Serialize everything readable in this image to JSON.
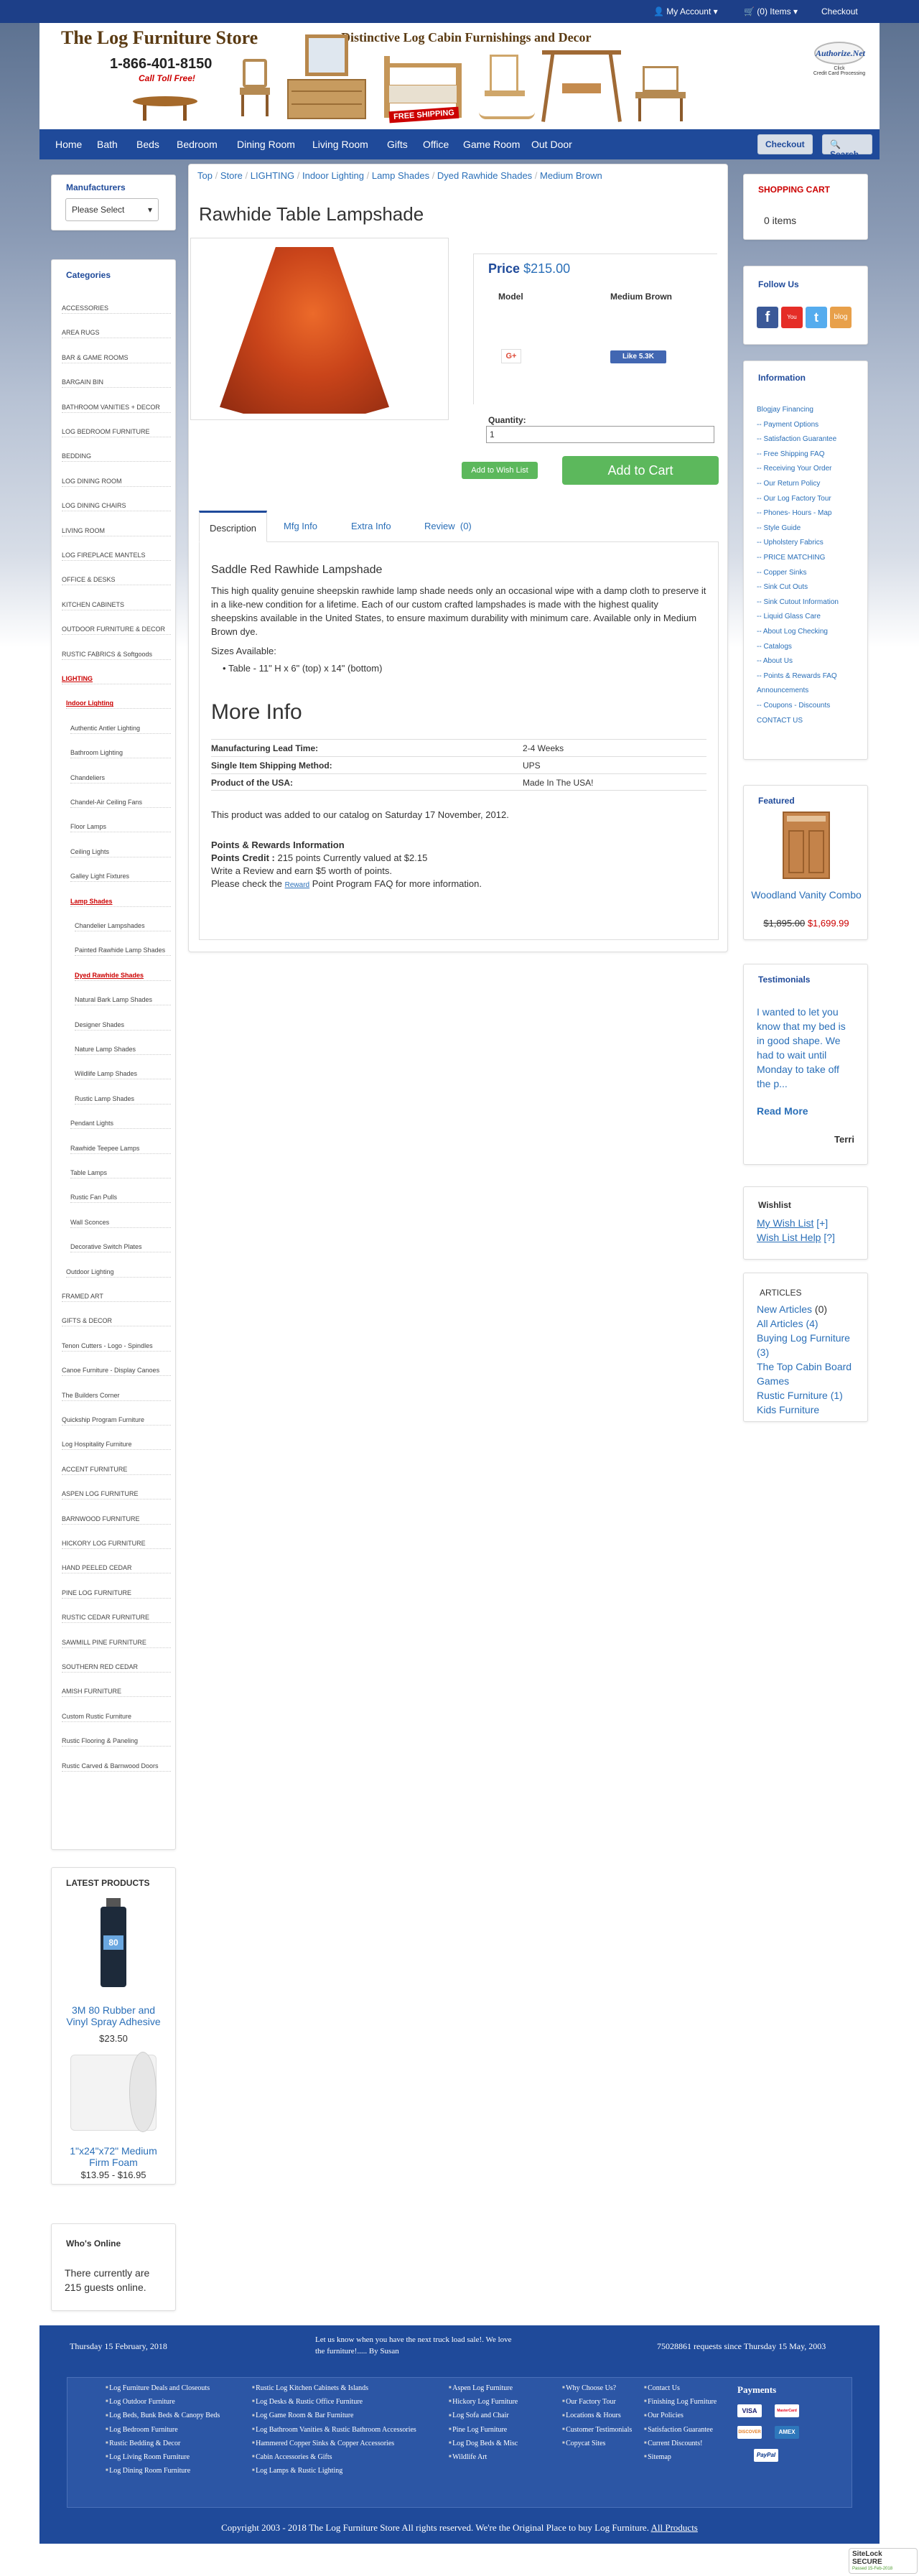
{
  "topbar": {
    "account": "My Account",
    "cart": "(0) Items",
    "checkout": "Checkout"
  },
  "header": {
    "store_name": "The Log Furniture Store",
    "tagline": "Distinctive Log Cabin Furnishings and Decor",
    "phone": "1-866-401-8150",
    "toll_free": "Call Toll Free!",
    "free_shipping": "FREE SHIPPING",
    "authorize": "Authorize.Net",
    "authorize_sub": "Credit Card Processing",
    "click": "Click"
  },
  "nav": {
    "items": [
      "Home",
      "Bath",
      "Beds",
      "Bedroom",
      "Dining Room",
      "Living Room",
      "Gifts",
      "Office",
      "Game Room",
      "Out Door"
    ],
    "checkout": "Checkout",
    "search": "Search"
  },
  "manufacturers": {
    "title": "Manufacturers",
    "select": "Please Select"
  },
  "categories": {
    "title": "Categories",
    "items": [
      {
        "t": "ACCESSORIES",
        "lvl": 0
      },
      {
        "t": "AREA RUGS",
        "lvl": 0
      },
      {
        "t": "BAR & GAME ROOMS",
        "lvl": 0
      },
      {
        "t": "BARGAIN BIN",
        "lvl": 0
      },
      {
        "t": "BATHROOM VANITIES + DECOR",
        "lvl": 0
      },
      {
        "t": "LOG BEDROOM FURNITURE",
        "lvl": 0
      },
      {
        "t": "BEDDING",
        "lvl": 0
      },
      {
        "t": "LOG DINING ROOM",
        "lvl": 0
      },
      {
        "t": "LOG DINING CHAIRS",
        "lvl": 0
      },
      {
        "t": "LIVING ROOM",
        "lvl": 0
      },
      {
        "t": "LOG FIREPLACE MANTELS",
        "lvl": 0
      },
      {
        "t": "OFFICE & DESKS",
        "lvl": 0
      },
      {
        "t": "KITCHEN CABINETS",
        "lvl": 0
      },
      {
        "t": "OUTDOOR FURNITURE & DECOR",
        "lvl": 0
      },
      {
        "t": "RUSTIC FABRICS & Softgoods",
        "lvl": 0
      },
      {
        "t": "LIGHTING",
        "lvl": 0,
        "red": true
      },
      {
        "t": "Indoor Lighting",
        "lvl": 1,
        "red": true
      },
      {
        "t": "Authentic Antler Lighting",
        "lvl": 2
      },
      {
        "t": "Bathroom Lighting",
        "lvl": 2
      },
      {
        "t": "Chandeliers",
        "lvl": 2
      },
      {
        "t": "Chandel-Air Ceiling Fans",
        "lvl": 2
      },
      {
        "t": "Floor Lamps",
        "lvl": 2
      },
      {
        "t": "Ceiling Lights",
        "lvl": 2
      },
      {
        "t": "Galley Light Fixtures",
        "lvl": 2
      },
      {
        "t": "Lamp Shades",
        "lvl": 2,
        "red": true
      },
      {
        "t": "Chandelier Lampshades",
        "lvl": 3
      },
      {
        "t": "Painted Rawhide Lamp Shades",
        "lvl": 3
      },
      {
        "t": "Dyed Rawhide Shades",
        "lvl": 3,
        "red": true
      },
      {
        "t": "Natural Bark Lamp Shades",
        "lvl": 3
      },
      {
        "t": "Designer Shades",
        "lvl": 3
      },
      {
        "t": "Nature Lamp Shades",
        "lvl": 3
      },
      {
        "t": "Wildlife Lamp Shades",
        "lvl": 3
      },
      {
        "t": "Rustic Lamp Shades",
        "lvl": 3
      },
      {
        "t": "Pendant Lights",
        "lvl": 2
      },
      {
        "t": "Rawhide Teepee Lamps",
        "lvl": 2
      },
      {
        "t": "Table Lamps",
        "lvl": 2
      },
      {
        "t": "Rustic Fan Pulls",
        "lvl": 2
      },
      {
        "t": "Wall Sconces",
        "lvl": 2
      },
      {
        "t": "Decorative Switch Plates",
        "lvl": 2
      },
      {
        "t": "Outdoor Lighting",
        "lvl": 1
      },
      {
        "t": "FRAMED ART",
        "lvl": 0
      },
      {
        "t": "GIFTS & DECOR",
        "lvl": 0
      },
      {
        "t": "Tenon Cutters - Logo - Spindles",
        "lvl": 0
      },
      {
        "t": "Canoe Furniture - Display Canoes",
        "lvl": 0
      },
      {
        "t": "The Builders Corner",
        "lvl": 0
      },
      {
        "t": "Quickship Program Furniture",
        "lvl": 0
      },
      {
        "t": "Log Hospitality Furniture",
        "lvl": 0
      },
      {
        "t": "ACCENT FURNITURE",
        "lvl": 0
      },
      {
        "t": "ASPEN LOG FURNITURE",
        "lvl": 0
      },
      {
        "t": "BARNWOOD FURNITURE",
        "lvl": 0
      },
      {
        "t": "HICKORY LOG FURNITURE",
        "lvl": 0
      },
      {
        "t": "HAND PEELED CEDAR",
        "lvl": 0
      },
      {
        "t": "PINE LOG FURNITURE",
        "lvl": 0
      },
      {
        "t": "RUSTIC CEDAR FURNITURE",
        "lvl": 0
      },
      {
        "t": "SAWMILL PINE FURNITURE",
        "lvl": 0
      },
      {
        "t": "SOUTHERN RED CEDAR",
        "lvl": 0
      },
      {
        "t": "AMISH FURNITURE",
        "lvl": 0
      },
      {
        "t": "Custom Rustic Furniture",
        "lvl": 0
      },
      {
        "t": "Rustic Flooring & Paneling",
        "lvl": 0
      },
      {
        "t": "Rustic Carved & Barnwood Doors",
        "lvl": 0
      }
    ]
  },
  "latest": {
    "title": "LATEST PRODUCTS",
    "p1": {
      "name": "3M 80 Rubber and Vinyl Spray Adhesive",
      "price": "$23.50",
      "label": "80"
    },
    "p2": {
      "name": "1\"x24\"x72\" Medium Firm Foam",
      "price": "$13.95 - $16.95"
    }
  },
  "online": {
    "title": "Who's Online",
    "text": "There currently are 215 guests online."
  },
  "breadcrumb": [
    "Top",
    "Store",
    "LIGHTING",
    "Indoor Lighting",
    "Lamp Shades",
    "Dyed Rawhide Shades",
    "Medium Brown"
  ],
  "product": {
    "title": "Rawhide Table Lampshade",
    "price_label": "Price",
    "price": "$215.00",
    "model_label": "Model",
    "model": "Medium Brown",
    "gplus": "G+",
    "fb": "Like 5.3K",
    "qty_label": "Quantity:",
    "qty": "1",
    "wishlist": "Add to Wish List",
    "add_to_cart": "Add to Cart",
    "tabs": [
      "Description",
      "Mfg Info",
      "Extra Info",
      "Review",
      "(0)"
    ],
    "subtitle": "Saddle Red Rawhide Lampshade",
    "desc": "This high quality genuine sheepskin rawhide lamp shade needs only an occasional wipe with a damp cloth to preserve it in a like-new condition for a lifetime. Each of our custom crafted lampshades is made with the highest quality sheepskins available in the United States, to ensure maximum durability with minimum care. Available only in Medium Brown dye.",
    "sizes_label": "Sizes Available:",
    "size": "Table - 11\" H x 6\" (top) x 14\" (bottom)",
    "more_info": "More Info",
    "info": [
      [
        "Manufacturing Lead Time:",
        "2-4 Weeks"
      ],
      [
        "Single Item Shipping Method:",
        "UPS"
      ],
      [
        "Product of the USA:",
        "Made In The USA!"
      ]
    ],
    "added": "This product was added to our catalog on Saturday 17 November, 2012.",
    "points_title": "Points & Rewards Information",
    "points_credit_label": "Points Credit :",
    "points_credit": "215 points Currently valued at $2.15",
    "points_review": "Write a Review and earn $5 worth of points.",
    "points_pre": "Please check the",
    "points_link": "Reward",
    "points_post": "Point Program FAQ for more information."
  },
  "cart": {
    "title": "SHOPPING CART",
    "items": "0 items"
  },
  "follow": {
    "title": "Follow Us",
    "yt": "You Tube",
    "blog": "blog"
  },
  "information": {
    "title": "Information",
    "items": [
      "Blogjay Financing",
      "-- Payment Options",
      "-- Satisfaction Guarantee",
      "-- Free Shipping FAQ",
      "-- Receiving Your Order",
      "-- Our Return Policy",
      "-- Our Log Factory Tour",
      "-- Phones- Hours - Map",
      "-- Style Guide",
      "-- Upholstery Fabrics",
      "-- PRICE MATCHING",
      "-- Copper Sinks",
      "-- Sink Cut Outs",
      "-- Sink Cutout Information",
      "-- Liquid Glass Care",
      "-- About Log Checking",
      "-- Catalogs",
      "-- About Us",
      "-- Points & Rewards FAQ",
      "Announcements",
      "-- Coupons - Discounts",
      "CONTACT US"
    ]
  },
  "featured": {
    "title": "Featured",
    "name": "Woodland Vanity Combo",
    "old": "$1,895.00",
    "new": "$1,699.99"
  },
  "testimonials": {
    "title": "Testimonials",
    "text": "I wanted to let you know that my bed is in good shape. We had to wait until Monday to take off the p...",
    "read_more": "Read More",
    "author": "Terri"
  },
  "wishlist": {
    "title": "Wishlist",
    "my": "My Wish List",
    "my_count": "[+]",
    "help": "Wish List Help",
    "help_q": "[?]"
  },
  "articles": {
    "title": "ARTICLES",
    "items": [
      "New Articles",
      "All Articles (4)",
      "Buying Log Furniture (3)",
      "The Top Cabin Board Games",
      "Rustic Furniture (1)",
      "Kids Furniture"
    ],
    "counts": [
      "(0)",
      "",
      "",
      "",
      "",
      ""
    ]
  },
  "footer": {
    "date": "Thursday 15 February, 2018",
    "message": "Let us know when you have the next truck load sale!. We love the furniture!..... By Susan",
    "requests": "75028861 requests since Thursday 15 May, 2003",
    "col1": [
      "Log Furniture Deals and Closeouts",
      "Log Outdoor Furniture",
      "Log Beds, Bunk Beds & Canopy Beds",
      "Log Bedroom Furniture",
      "Rustic Bedding & Decor",
      "Log Living Room Furniture",
      "Log Dining Room Furniture"
    ],
    "col2": [
      "Rustic Log Kitchen Cabinets & Islands",
      "Log Desks & Rustic Office Furniture",
      "Log Game Room & Bar Furniture",
      "Log Bathroom Vanities & Rustic Bathroom Accessories",
      "Hammered Copper Sinks & Copper Accessories",
      "Cabin Accessories & Gifts",
      "Log Lamps & Rustic Lighting"
    ],
    "col3": [
      "Aspen Log Furniture",
      "Hickory Log Furniture",
      "Log Sofa and Chair",
      "Pine Log Furniture",
      "Log Dog Beds & Misc",
      "Wildlife Art"
    ],
    "col4": [
      "Why Choose Us?",
      "Our Factory Tour",
      "Locations & Hours",
      "Customer Testimonials",
      "Copycat Sites"
    ],
    "col5": [
      "Contact Us",
      "Finishing Log Furniture",
      "Our Policies",
      "Satisfaction Guarantee",
      "Current Discounts!",
      "Sitemap"
    ],
    "payments": "Payments",
    "pay_names": [
      "VISA",
      "MasterCard",
      "DISCOVER",
      "AMEX",
      "PayPal"
    ],
    "copyright": "Copyright 2003 - 2018 The Log Furniture Store All rights reserved. We're the Original Place to buy Log Furniture.",
    "copyright_link": "All Products"
  },
  "sitelock": {
    "name": "SiteLock",
    "secure": "SECURE",
    "passed": "Passed 15-Feb-2018"
  },
  "colors": {
    "brand": "#1f4a9a",
    "green": "#5cb85c",
    "red": "#c00"
  }
}
